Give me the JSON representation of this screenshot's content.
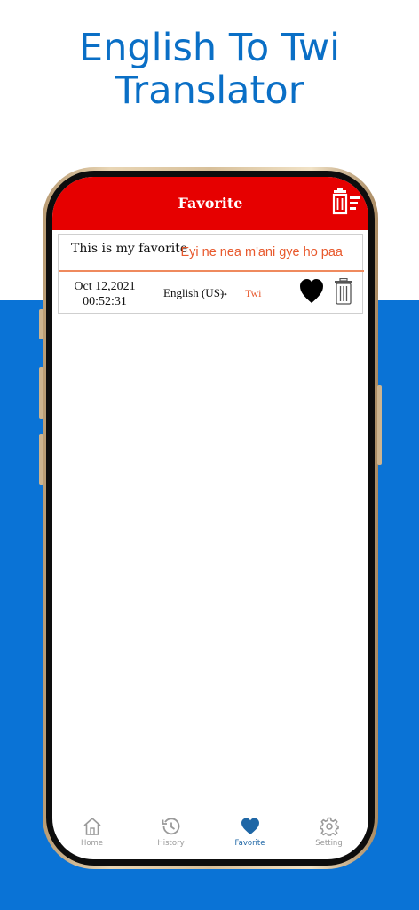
{
  "promo": {
    "headline_line1": "English To Twi",
    "headline_line2": "Translator"
  },
  "appbar": {
    "title": "Favorite"
  },
  "favorite_card": {
    "source_text": "This is my favorite",
    "translated_text": "Eyi ne nea m'ani gye ho paa",
    "date": "Oct 12,2021",
    "time": "00:52:31",
    "from_language": "English (US)",
    "arrow": "→",
    "to_language": "Twi"
  },
  "tabbar": {
    "items": [
      {
        "label": "Home",
        "icon": "home-icon"
      },
      {
        "label": "History",
        "icon": "history-icon"
      },
      {
        "label": "Favorite",
        "icon": "heart-icon"
      },
      {
        "label": "Setting",
        "icon": "gear-icon"
      }
    ],
    "active": "Favorite"
  },
  "colors": {
    "appbar": "#e60000",
    "background_band": "#0a73d6",
    "translation": "#e8592d",
    "active_tab": "#1f67a6"
  }
}
